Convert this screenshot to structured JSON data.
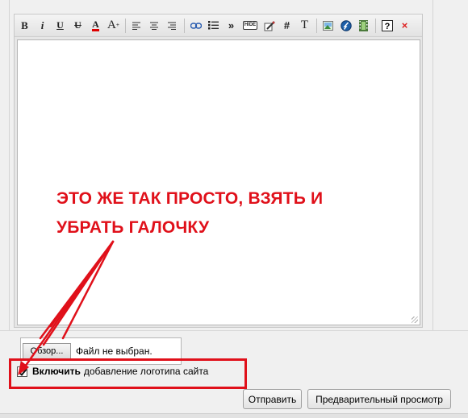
{
  "toolbar": {
    "buttons": [
      {
        "name": "bold",
        "glyph": "B"
      },
      {
        "name": "italic",
        "glyph": "i"
      },
      {
        "name": "underline",
        "glyph": "U"
      },
      {
        "name": "strikethrough",
        "glyph": "U"
      },
      {
        "name": "font-color",
        "glyph": "A"
      },
      {
        "name": "font-size",
        "glyph": "A"
      }
    ],
    "hash": "#",
    "text_t": "T",
    "hide": "HIDE",
    "close": "×"
  },
  "annotation": {
    "line1": "ЭТО ЖЕ ТАК ПРОСТО, ВЗЯТЬ И",
    "line2": "УБРАТЬ ГАЛОЧКУ",
    "color": "#e0101a"
  },
  "file_input": {
    "button_label": "Обзор...",
    "status": "Файл не выбран."
  },
  "logo_option": {
    "checked": true,
    "bold_label": "Включить",
    "label": "добавление логотипа сайта"
  },
  "actions": {
    "send": "Отправить",
    "preview": "Предварительный просмотр"
  }
}
